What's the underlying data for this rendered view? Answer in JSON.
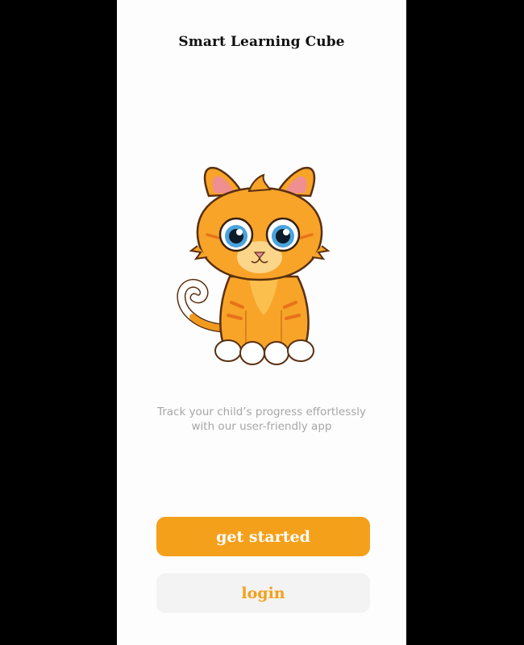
{
  "app": {
    "title": "Smart Learning Cube"
  },
  "hero": {
    "image": "orange-kitten-illustration",
    "tagline_line1": "Track your child’s progress effortlessly",
    "tagline_line2": "with our user-friendly app"
  },
  "actions": {
    "get_started_label": "get started",
    "login_label": "login"
  },
  "colors": {
    "accent": "#f5a01a",
    "screen_background": "#fdfdfd",
    "secondary_button": "#f3f3f3",
    "tagline_text": "#a6a6a6"
  }
}
